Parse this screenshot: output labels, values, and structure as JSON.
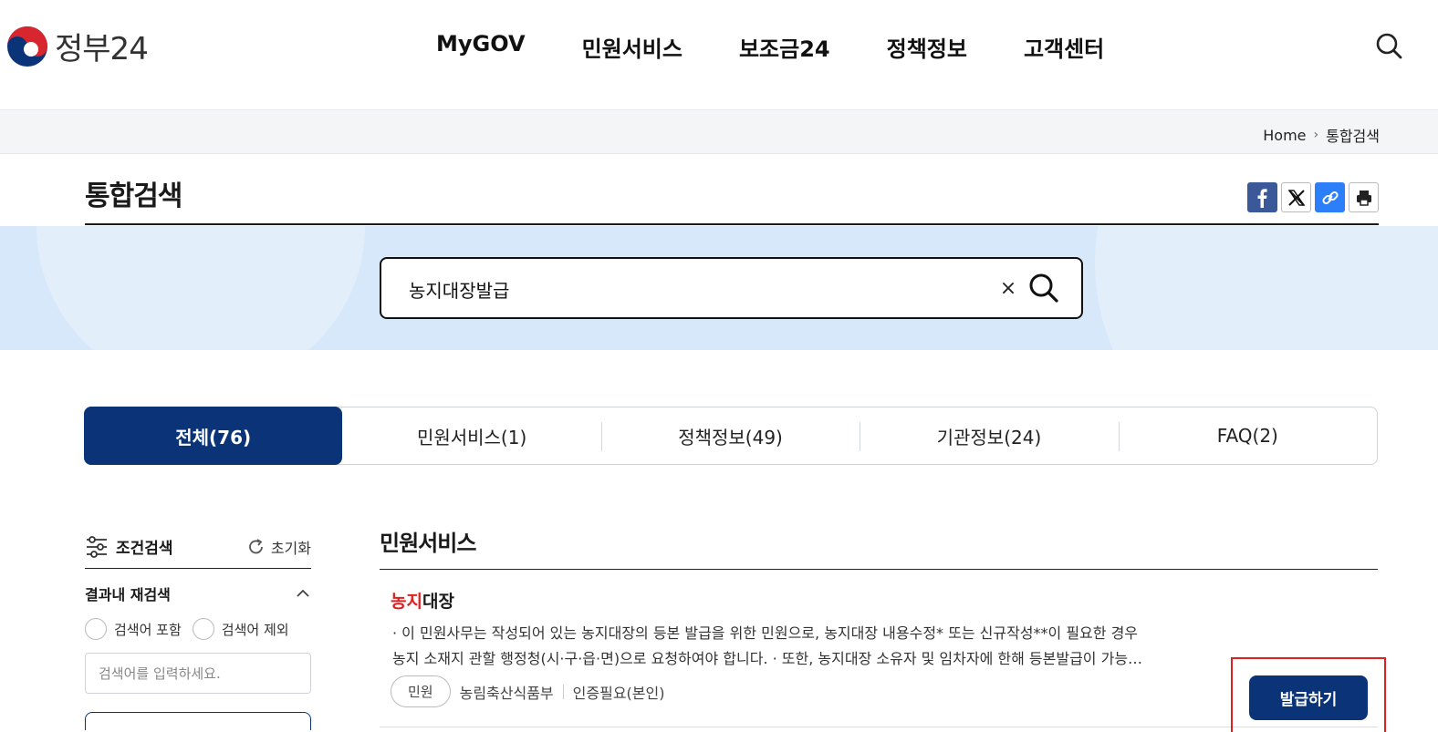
{
  "header": {
    "logo_text": "정부24",
    "nav": [
      "MyGOV",
      "민원서비스",
      "보조금24",
      "정책정보",
      "고객센터"
    ],
    "search_icon": "search-icon"
  },
  "breadcrumb": {
    "home": "Home",
    "current": "통합검색"
  },
  "page": {
    "title": "통합검색",
    "share_icons": [
      "facebook-icon",
      "x-icon",
      "link-icon",
      "print-icon"
    ]
  },
  "search": {
    "query": "농지대장발급",
    "clear_label": "×"
  },
  "tabs": [
    {
      "label": "전체(76)",
      "active": true
    },
    {
      "label": "민원서비스(1)",
      "active": false
    },
    {
      "label": "정책정보(49)",
      "active": false
    },
    {
      "label": "기관정보(24)",
      "active": false
    },
    {
      "label": "FAQ(2)",
      "active": false
    }
  ],
  "sidebar": {
    "title": "조건검색",
    "reset_label": "초기화",
    "refine_title": "결과내 재검색",
    "include_label": "검색어 포함",
    "exclude_label": "검색어 제외",
    "input_placeholder": "검색어를 입력하세요."
  },
  "results": {
    "section_title": "민원서비스",
    "items": [
      {
        "title_highlight": "농지",
        "title_rest": "대장",
        "desc_line1": "· 이 민원사무는 작성되어 있는 농지대장의 등본 발급을 위한 민원으로, 농지대장 내용수정* 또는 신규작성**이 필요한 경우",
        "desc_line2": "농지 소재지 관할 행정청(시·구·읍·면)으로 요청하여야 합니다. · 또한, 농지대장 소유자 및 임차자에 한해 등본발급이 가능…",
        "tag": "민원",
        "agency": "농림축산식품부",
        "auth": "인증필요(본인)",
        "button_label": "발급하기"
      }
    ]
  },
  "colors": {
    "primary": "#0b3478",
    "highlight": "#e02020",
    "banner": "#d8e8fb"
  }
}
